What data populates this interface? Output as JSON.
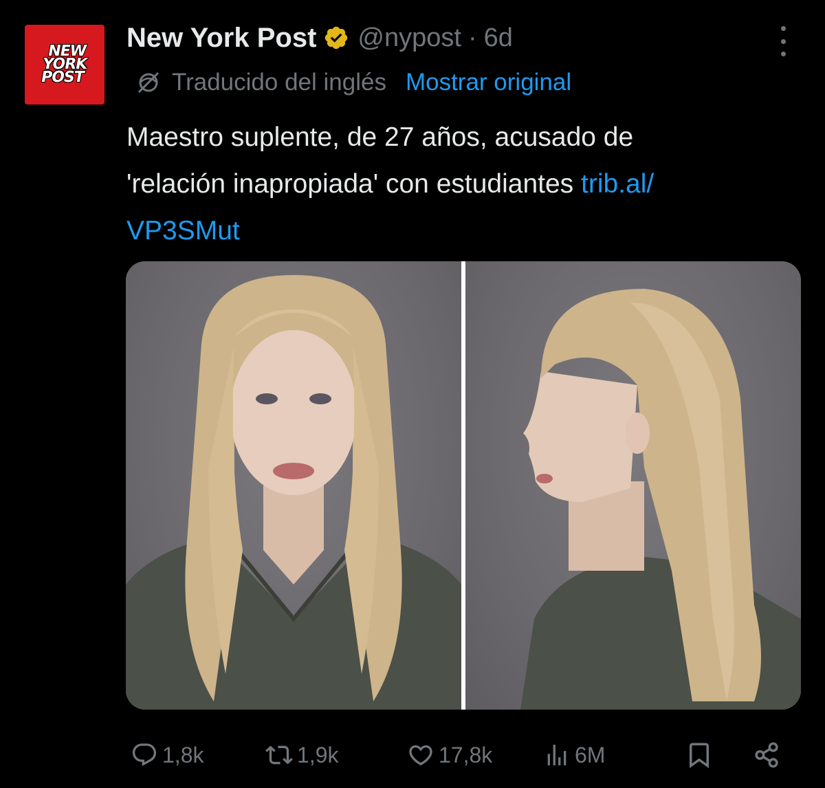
{
  "author": {
    "avatar_lines": [
      "NEW",
      "YORK",
      "POST"
    ],
    "name": "New York Post",
    "verified_badge": "gold-verified-checkmark",
    "handle": "@nypost",
    "separator": "·",
    "time": "6d"
  },
  "translation": {
    "label": "Traducido del inglés",
    "show_original": "Mostrar original"
  },
  "tweet": {
    "line1": "Maestro suplente, de 27 años, acusado de",
    "line2_text": "'relación inapropiada' con estudiantes ",
    "link_part1": "trib.al/",
    "link_part2": "VP3SMut"
  },
  "media": {
    "count": 2,
    "description_icons": [
      "photo-front",
      "photo-profile"
    ]
  },
  "actions": {
    "replies": "1,8k",
    "reposts": "1,9k",
    "likes": "17,8k",
    "views": "6M"
  },
  "colors": {
    "background": "#000000",
    "text": "#e7e9ea",
    "muted": "#71767b",
    "link": "#1d9bf0",
    "brand_red": "#d6191e",
    "verified_gold": "#e2b719"
  }
}
